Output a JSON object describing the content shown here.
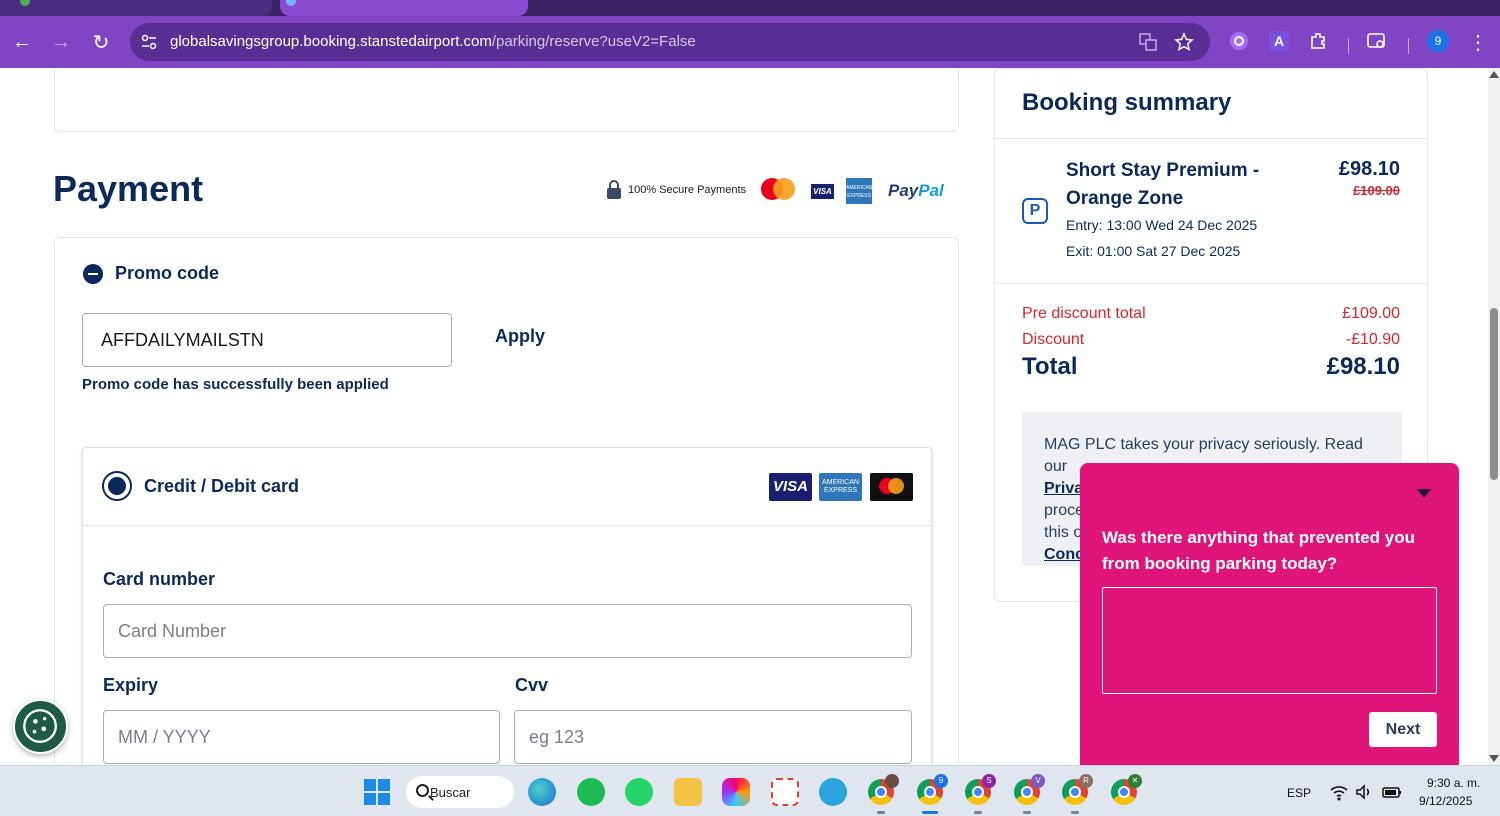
{
  "browser": {
    "url_host": "globalsavingsgroup.booking.stanstedairport.com",
    "url_path": "/parking/reserve?useV2=False",
    "profile_initial": "9"
  },
  "payment": {
    "title": "Payment",
    "secure_text": "100% Secure Payments",
    "visa_small": "VISA",
    "amex_small": "AMERICAN EXPRESS",
    "paypal_pay": "Pay",
    "paypal_pal": "Pal",
    "promo": {
      "label": "Promo code",
      "value": "AFFDAILYMAILSTN",
      "apply_label": "Apply",
      "success_msg": "Promo code has successfully been applied"
    },
    "card": {
      "title": "Credit / Debit card",
      "visa": "VISA",
      "amex": "AMERICAN EXPRESS",
      "card_number_label": "Card number",
      "card_number_placeholder": "Card Number",
      "expiry_label": "Expiry",
      "expiry_placeholder": "MM / YYYY",
      "cvv_label": "Cvv",
      "cvv_placeholder": "eg 123"
    }
  },
  "summary": {
    "title": "Booking summary",
    "product_name": "Short Stay Premium - Orange Zone",
    "price": "£98.10",
    "old_price": "£109.00",
    "entry": "Entry: 13:00 Wed 24 Dec 2025",
    "exit": "Exit: 01:00 Sat 27 Dec 2025",
    "pre_discount_label": "Pre discount total",
    "pre_discount_value": "£109.00",
    "discount_label": "Discount",
    "discount_value": "-£10.90",
    "total_label": "Total",
    "total_value": "£98.10",
    "privacy_text_1": "MAG PLC takes your privacy seriously. Read our",
    "privacy_link": "Priva",
    "privacy_text_2": "proce",
    "privacy_text_3": "this o",
    "privacy_link_2": "Conc"
  },
  "survey": {
    "question": "Was there anything that prevented you from booking parking today?",
    "next_label": "Next"
  },
  "taskbar": {
    "search_label": "Buscar",
    "language": "ESP",
    "time": "9:30 a. m.",
    "date": "9/12/2025",
    "chrome_badges": [
      "9",
      "S",
      "V",
      "R",
      "✕"
    ]
  },
  "colors": {
    "brand_navy": "#0b2a5b",
    "discount_red": "#d9262c",
    "survey_pink": "#e0157a",
    "browser_purple": "#7f45c4"
  }
}
